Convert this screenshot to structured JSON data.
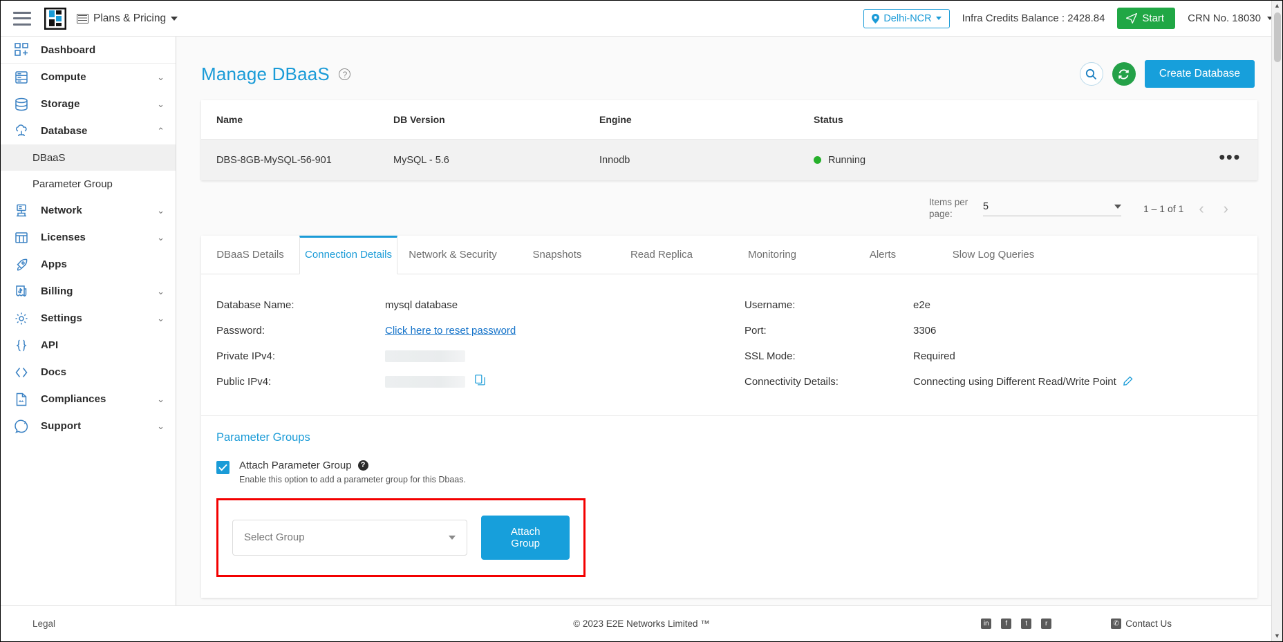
{
  "topbar": {
    "menu_icon": "hamburger-icon",
    "logo_alt": "E2E Networks",
    "plans_label": "Plans & Pricing",
    "region": "Delhi-NCR",
    "credits": "Infra Credits Balance : 2428.84",
    "start_label": "Start",
    "crn_label": "CRN No. 18030"
  },
  "sidebar": {
    "items": [
      {
        "label": "Dashboard",
        "icon": "dashboard-icon",
        "chevron": ""
      },
      {
        "label": "Compute",
        "icon": "server-icon",
        "chevron": "down"
      },
      {
        "label": "Storage",
        "icon": "database-icon",
        "chevron": "down"
      },
      {
        "label": "Database",
        "icon": "cloud-db-icon",
        "chevron": "up"
      },
      {
        "label": "Network",
        "icon": "network-icon",
        "chevron": "down"
      },
      {
        "label": "Licenses",
        "icon": "licenses-icon",
        "chevron": "down"
      },
      {
        "label": "Apps",
        "icon": "rocket-icon",
        "chevron": ""
      },
      {
        "label": "Billing",
        "icon": "billing-icon",
        "chevron": "down"
      },
      {
        "label": "Settings",
        "icon": "gear-icon",
        "chevron": "down"
      },
      {
        "label": "API",
        "icon": "braces-icon",
        "chevron": ""
      },
      {
        "label": "Docs",
        "icon": "code-icon",
        "chevron": ""
      },
      {
        "label": "Compliances",
        "icon": "document-icon",
        "chevron": "down"
      },
      {
        "label": "Support",
        "icon": "support-icon",
        "chevron": "down"
      }
    ],
    "sub_items": [
      {
        "label": "DBaaS",
        "active": true
      },
      {
        "label": "Parameter Group",
        "active": false
      }
    ]
  },
  "page": {
    "title": "Manage DBaaS",
    "help_icon": "question-circle-icon",
    "search_icon": "search-icon",
    "refresh_icon": "refresh-icon",
    "create_button": "Create Database"
  },
  "table": {
    "headers": [
      "Name",
      "DB Version",
      "Engine",
      "Status"
    ],
    "rows": [
      {
        "name": "DBS-8GB-MySQL-56-901",
        "db_version": "MySQL - 5.6",
        "engine": "Innodb",
        "status": "Running",
        "status_color": "#26b02b",
        "actions": "•••"
      }
    ]
  },
  "paginator": {
    "items_per_page_label": "Items per page:",
    "items_per_page_value": "5",
    "range": "1 – 1 of 1",
    "prev_icon": "chevron-left-icon",
    "next_icon": "chevron-right-icon"
  },
  "tabs": [
    {
      "label": "DBaaS Details",
      "active": false
    },
    {
      "label": "Connection Details",
      "active": true
    },
    {
      "label": "Network & Security",
      "active": false
    },
    {
      "label": "Snapshots",
      "active": false
    },
    {
      "label": "Read Replica",
      "active": false
    },
    {
      "label": "Monitoring",
      "active": false
    },
    {
      "label": "Alerts",
      "active": false
    },
    {
      "label": "Slow Log Queries",
      "active": false
    }
  ],
  "connection": {
    "left": [
      {
        "label": "Database Name:",
        "value": "mysql database",
        "type": "text"
      },
      {
        "label": "Password:",
        "value": "Click here to reset password",
        "type": "link"
      },
      {
        "label": "Private IPv4:",
        "value": "",
        "type": "redacted"
      },
      {
        "label": "Public IPv4:",
        "value": "",
        "type": "redacted-copy"
      }
    ],
    "right": [
      {
        "label": "Username:",
        "value": "e2e",
        "type": "text"
      },
      {
        "label": "Port:",
        "value": "3306",
        "type": "text"
      },
      {
        "label": "SSL Mode:",
        "value": "Required",
        "type": "text"
      },
      {
        "label": "Connectivity Details:",
        "value": "Connecting using Different Read/Write Point",
        "type": "text-edit"
      }
    ]
  },
  "parameter_groups": {
    "title": "Parameter Groups",
    "checkbox_label": "Attach Parameter Group",
    "checkbox_checked": true,
    "help_icon": "question-filled-icon",
    "hint": "Enable this option to add a parameter group for this Dbaas.",
    "select_placeholder": "Select Group",
    "attach_button": "Attach Group",
    "highlight_color": "#f30000"
  },
  "footer": {
    "legal": "Legal",
    "copyright_symbol": "© 2023 ",
    "copyright": "E2E Networks Limited ™",
    "social": [
      "in",
      "f",
      "t",
      "r"
    ],
    "contact": "Contact Us"
  },
  "colors": {
    "accent": "#1a9bd7",
    "green": "#20a745",
    "link": "#1372c9",
    "highlight": "#f30000"
  }
}
